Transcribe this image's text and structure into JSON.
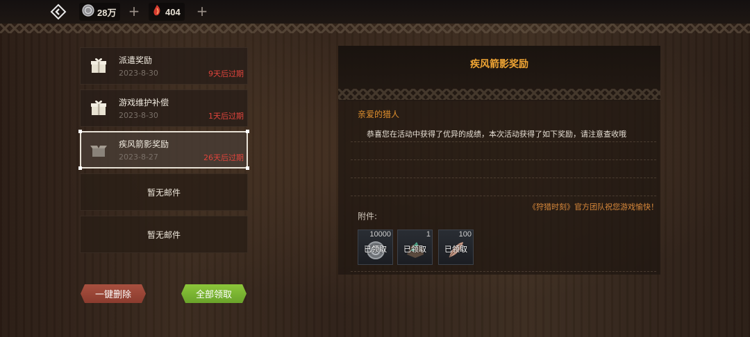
{
  "topbar": {
    "coins": {
      "icon": "silver-coin-icon",
      "value": "28万"
    },
    "gems": {
      "icon": "red-crystal-icon",
      "value": "404"
    },
    "plus": "+"
  },
  "mail_list": [
    {
      "title": "派遣奖励",
      "date": "2023-8-30",
      "expire": "9天后过期",
      "icon": "gift-box-icon",
      "selected": false
    },
    {
      "title": "游戏维护补偿",
      "date": "2023-8-30",
      "expire": "1天后过期",
      "icon": "gift-box-icon",
      "selected": false
    },
    {
      "title": "疾风箭影奖励",
      "date": "2023-8-27",
      "expire": "26天后过期",
      "icon": "opened-box-icon",
      "selected": true
    }
  ],
  "empty_slots": [
    "暂无邮件",
    "暂无邮件"
  ],
  "buttons": {
    "delete_all": "一键删除",
    "claim_all": "全部领取"
  },
  "detail": {
    "title": "疾风箭影奖励",
    "greeting": "亲爱的猎人",
    "body": "恭喜您在活动中获得了优异的成绩，本次活动获得了如下奖励，请注意查收哦",
    "signature": "《狩猎时刻》官方团队祝您游戏愉快！",
    "attachment_label": "附件:",
    "attachments": [
      {
        "qty": "10000",
        "status": "已领取",
        "icon": "silver-coin-icon"
      },
      {
        "qty": "1",
        "status": "已领取",
        "icon": "ore-icon"
      },
      {
        "qty": "100",
        "status": "已领取",
        "icon": "feather-icon"
      }
    ]
  },
  "colors": {
    "accent_orange": "#f0a534",
    "expire_red": "#e0443c",
    "claim_green": "#7ab832",
    "delete_red": "#a04a3a"
  }
}
